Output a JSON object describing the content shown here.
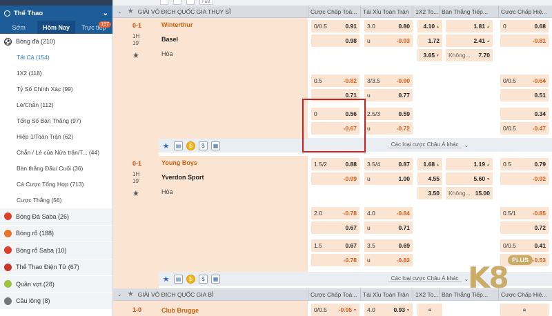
{
  "sidebar": {
    "header": "Thể Thao",
    "tabs": [
      {
        "label": "Sớm"
      },
      {
        "label": "Hôm Nay"
      },
      {
        "label": "Trực tiếp",
        "badge": "157"
      }
    ],
    "main_sport": "Bóng đá (210)",
    "sub_items": [
      "Tất Cả (154)",
      "1X2 (118)",
      "Tỷ Số Chính Xác (99)",
      "Lẻ/Chẵn (112)",
      "Tổng Số Bàn Thắng (97)",
      "Hiệp 1/Toàn Trận (62)",
      "Chẵn / Lẻ của Nửa trận/T... (44)",
      "Bàn thắng Đầu/ Cuối (36)",
      "Cá Cược Tổng Hợp (713)",
      "Cược Thắng (56)"
    ],
    "other_sports": [
      {
        "label": "Bóng Đá Saba (26)",
        "icon": "soccer-ball-icon",
        "color": "#d9412b"
      },
      {
        "label": "Bóng rổ (188)",
        "icon": "basketball-icon",
        "color": "#e8742a"
      },
      {
        "label": "Bóng rổ Saba (10)",
        "icon": "basketball-icon",
        "color": "#d9412b"
      },
      {
        "label": "Thể Thao Điện Tử (67)",
        "icon": "esports-icon",
        "color": "#c6342a"
      },
      {
        "label": "Quần vợt (28)",
        "icon": "tennis-ball-icon",
        "color": "#9bc53d"
      },
      {
        "label": "Cầu lông (8)",
        "icon": "badminton-icon",
        "color": "#777777"
      }
    ]
  },
  "toolbar": {
    "fast_label": "Fast"
  },
  "league1": {
    "name": "GIẢI VÔ ĐỊCH QUỐC GIA THỤY SĨ",
    "columns": [
      "Cược Chấp Toà...",
      "Tài Xỉu Toàn Trận",
      "1X2 To...",
      "Bàn Thắng Tiếp...",
      "Cược Chấp Hiệ..."
    ]
  },
  "league2": {
    "name": "GIẢI VÔ ĐỊCH QUỐC GIA BỈ",
    "columns": [
      "Cược Chấp Toà...",
      "Tài Xỉu Toàn Trận",
      "1X2 To...",
      "Bàn Thắng Tiếp...",
      "Cược Chấp Hiệ..."
    ]
  },
  "match1": {
    "score": "0-1",
    "half": "1H",
    "minute": "19'",
    "home": "Winterthur",
    "away": "Basel",
    "draw": "Hòa",
    "more_label": "Các loại cược Châu Á khác",
    "rows": [
      {
        "ah_h1": "0/0.5",
        "ah_o1": "0.91",
        "ah_h2": "",
        "ah_o2": "0.98",
        "ou_h1": "3.0",
        "ou_o1": "0.80",
        "ou_h2": "u",
        "ou_o2": "-0.93",
        "x1": "4.10",
        "x2": "1.72",
        "x3": "3.65",
        "ng1": "1.81",
        "ng2": "2.41",
        "ng3_label": "Không...",
        "ng3": "7.70",
        "hah_h1": "0",
        "hah_o1": "0.68",
        "hah_h2": "",
        "hah_o2": "-0.81"
      },
      {
        "ah_h1": "0.5",
        "ah_o1": "-0.82",
        "ah_h2": "",
        "ah_o2": "0.71",
        "ou_h1": "3/3.5",
        "ou_o1": "-0.90",
        "ou_h2": "u",
        "ou_o2": "0.77",
        "hah_h1": "0/0.5",
        "hah_o1": "-0.64",
        "hah_h2": "",
        "hah_o2": "0.51"
      },
      {
        "ah_h1": "0",
        "ah_o1": "0.56",
        "ah_h2": "",
        "ah_o2": "-0.67",
        "ou_h1": "2.5/3",
        "ou_o1": "0.59",
        "ou_h2": "u",
        "ou_o2": "-0.72",
        "hah_h1": "",
        "hah_o1": "0.34",
        "hah_h2": "0/0.5",
        "hah_o2": "-0.47"
      }
    ]
  },
  "match2": {
    "score": "0-1",
    "half": "1H",
    "minute": "19'",
    "home": "Young Boys",
    "away": "Yverdon Sport",
    "draw": "Hòa",
    "more_label": "Các loại cược Châu Á khác",
    "rows": [
      {
        "ah_h1": "1.5/2",
        "ah_o1": "0.88",
        "ah_h2": "",
        "ah_o2": "-0.99",
        "ou_h1": "3.5/4",
        "ou_o1": "0.87",
        "ou_h2": "u",
        "ou_o2": "1.00",
        "x1": "1.68",
        "x2": "4.55",
        "x3": "3.50",
        "ng1": "1.19",
        "ng2": "5.60",
        "ng3_label": "Không...",
        "ng3": "15.00",
        "hah_h1": "0.5",
        "hah_o1": "0.79",
        "hah_h2": "",
        "hah_o2": "-0.92"
      },
      {
        "ah_h1": "2.0",
        "ah_o1": "-0.78",
        "ah_h2": "",
        "ah_o2": "0.67",
        "ou_h1": "4.0",
        "ou_o1": "-0.84",
        "ou_h2": "u",
        "ou_o2": "0.71",
        "hah_h1": "0.5/1",
        "hah_o1": "-0.85",
        "hah_h2": "",
        "hah_o2": "0.72"
      },
      {
        "ah_h1": "1.5",
        "ah_o1": "0.67",
        "ah_h2": "",
        "ah_o2": "-0.78",
        "ou_h1": "3.5",
        "ou_o1": "0.69",
        "ou_h2": "u",
        "ou_o2": "-0.82",
        "hah_h1": "0/0.5",
        "hah_o1": "0.41",
        "hah_h2": "",
        "hah_o2": "-0.53"
      }
    ]
  },
  "match3": {
    "score": "1-0",
    "home": "Club Brugge",
    "ah_h1": "0/0.5",
    "ah_o1": "-0.95",
    "ou_h1": "4.0",
    "ou_o1": "0.93"
  },
  "logo": {
    "text": "K8",
    "badge": "PLUS"
  }
}
